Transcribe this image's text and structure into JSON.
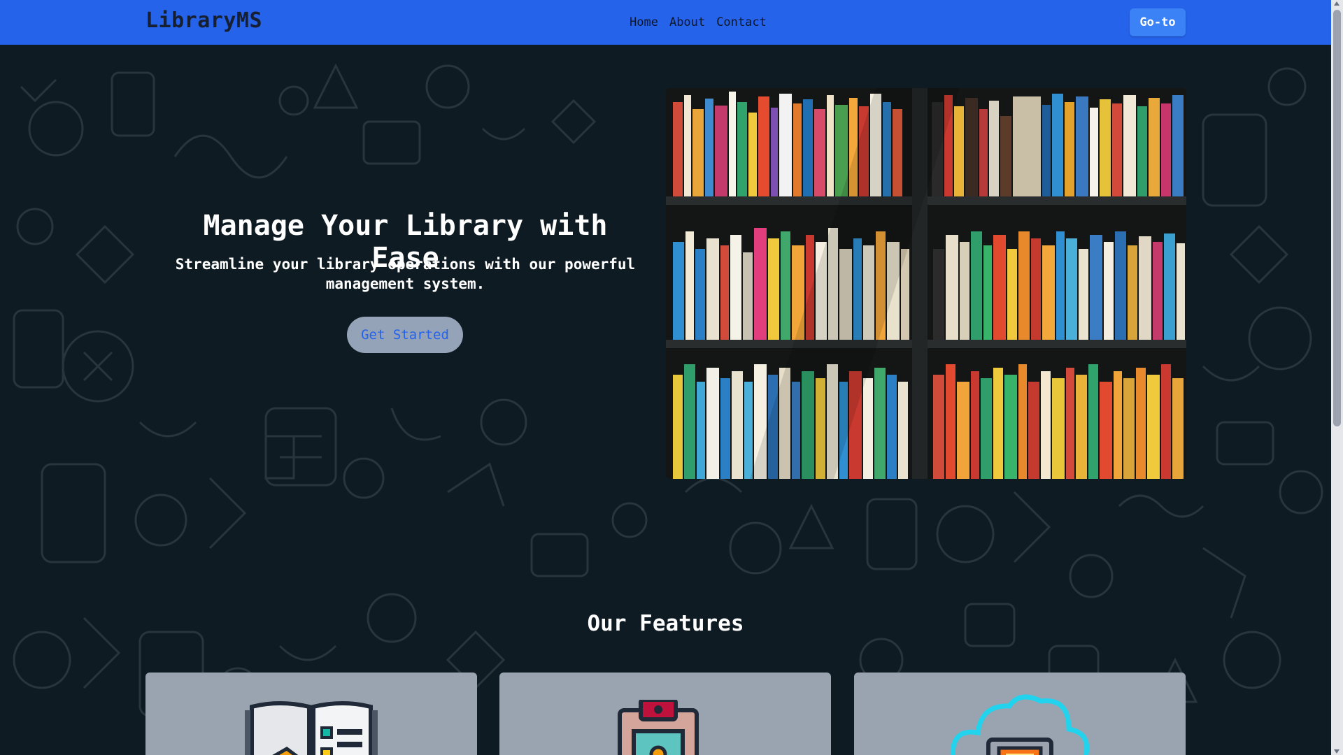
{
  "header": {
    "brand": "LibraryMS",
    "nav": [
      "Home",
      "About",
      "Contact"
    ],
    "goto_label": "Go-to"
  },
  "hero": {
    "title": "Manage Your Library with Ease",
    "subtitle": "Streamline your library operations with our powerful management system.",
    "cta_label": "Get Started"
  },
  "features": {
    "title": "Our Features",
    "cards": [
      {
        "icon": "open-book-icon"
      },
      {
        "icon": "id-badge-icon"
      },
      {
        "icon": "cloud-book-icon"
      }
    ]
  },
  "colors": {
    "header": "#2563eb",
    "button": "#3b82f6",
    "background": "#0f1b22",
    "card": "#9aa3b0"
  }
}
